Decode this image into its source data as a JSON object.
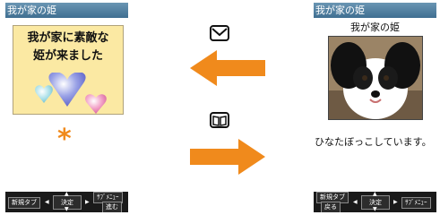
{
  "left_screen": {
    "title": "我が家の姫",
    "message_line1": "我が家に素敵な",
    "message_line2": "姫が来ました",
    "softkeys": {
      "left": "新規タブ",
      "center": "決定",
      "right_top": "ｻﾌﾞﾒﾆｭｰ",
      "right_bottom": "進む"
    }
  },
  "right_screen": {
    "title": "我が家の姫",
    "page_heading": "我が家の姫",
    "caption": "ひなたぼっこしています。",
    "softkeys": {
      "left_top": "新規タブ",
      "left_bottom": "戻る",
      "center": "決定",
      "right_top": "ｻﾌﾞﾒﾆｭｰ"
    }
  },
  "icons": {
    "mail": "mail-icon",
    "book": "book-icon",
    "arrow_left": "arrow-left-icon",
    "arrow_right": "arrow-right-icon"
  },
  "colors": {
    "accent_orange": "#f08a1c",
    "titlebar": "#4f7fa0",
    "card_yellow": "#fbe9a3"
  }
}
